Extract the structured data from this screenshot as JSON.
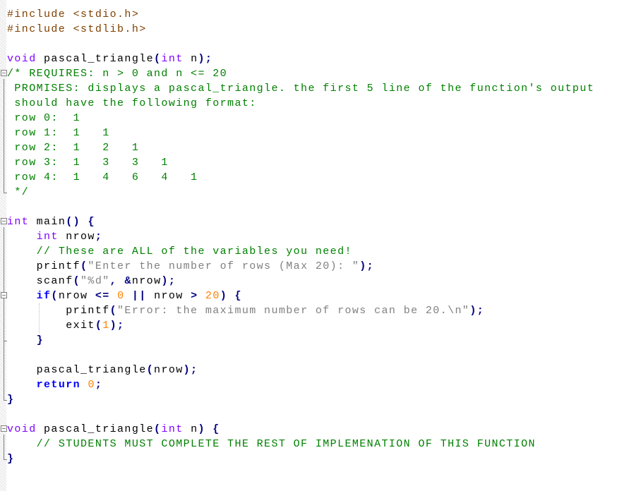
{
  "editor": {
    "lines": [
      [
        [
          "pp",
          "#include <stdio.h>"
        ]
      ],
      [
        [
          "pp",
          "#include <stdlib.h>"
        ]
      ],
      [],
      [
        [
          "type",
          "void"
        ],
        [
          "plain",
          " pascal_triangle"
        ],
        [
          "op",
          "("
        ],
        [
          "type",
          "int"
        ],
        [
          "plain",
          " n"
        ],
        [
          "op",
          ");"
        ]
      ],
      [
        [
          "cmt",
          "/* REQUIRES: n > 0 and n <= 20"
        ]
      ],
      [
        [
          "cmt",
          " PROMISES: displays a pascal_triangle. the first 5 line of the function's output"
        ]
      ],
      [
        [
          "cmt",
          " should have the following format:"
        ]
      ],
      [
        [
          "cmt",
          " row 0:  1"
        ]
      ],
      [
        [
          "cmt",
          " row 1:  1   1"
        ]
      ],
      [
        [
          "cmt",
          " row 2:  1   2   1"
        ]
      ],
      [
        [
          "cmt",
          " row 3:  1   3   3   1"
        ]
      ],
      [
        [
          "cmt",
          " row 4:  1   4   6   4   1"
        ]
      ],
      [
        [
          "cmt",
          " */"
        ]
      ],
      [],
      [
        [
          "type",
          "int"
        ],
        [
          "plain",
          " main"
        ],
        [
          "op",
          "()"
        ],
        [
          "plain",
          " "
        ],
        [
          "op",
          "{"
        ]
      ],
      [
        [
          "plain",
          "    "
        ],
        [
          "type",
          "int"
        ],
        [
          "plain",
          " nrow"
        ],
        [
          "op",
          ";"
        ]
      ],
      [
        [
          "plain",
          "    "
        ],
        [
          "cmt",
          "// These are ALL of the variables you need!"
        ]
      ],
      [
        [
          "plain",
          "    printf"
        ],
        [
          "op",
          "("
        ],
        [
          "str",
          "\"Enter the number of rows (Max 20): \""
        ],
        [
          "op",
          ");"
        ]
      ],
      [
        [
          "plain",
          "    scanf"
        ],
        [
          "op",
          "("
        ],
        [
          "str",
          "\"%d\""
        ],
        [
          "op",
          ","
        ],
        [
          "plain",
          " "
        ],
        [
          "op",
          "&"
        ],
        [
          "plain",
          "nrow"
        ],
        [
          "op",
          ");"
        ]
      ],
      [
        [
          "plain",
          "    "
        ],
        [
          "kw",
          "if"
        ],
        [
          "op",
          "("
        ],
        [
          "plain",
          "nrow "
        ],
        [
          "op",
          "<="
        ],
        [
          "plain",
          " "
        ],
        [
          "num",
          "0"
        ],
        [
          "plain",
          " "
        ],
        [
          "op",
          "||"
        ],
        [
          "plain",
          " nrow "
        ],
        [
          "op",
          ">"
        ],
        [
          "plain",
          " "
        ],
        [
          "num",
          "20"
        ],
        [
          "op",
          ")"
        ],
        [
          "plain",
          " "
        ],
        [
          "op",
          "{"
        ]
      ],
      [
        [
          "plain",
          "        printf"
        ],
        [
          "op",
          "("
        ],
        [
          "str",
          "\"Error: the maximum number of rows can be 20.\\n\""
        ],
        [
          "op",
          ");"
        ]
      ],
      [
        [
          "plain",
          "        exit"
        ],
        [
          "op",
          "("
        ],
        [
          "num",
          "1"
        ],
        [
          "op",
          ");"
        ]
      ],
      [
        [
          "plain",
          "    "
        ],
        [
          "op",
          "}"
        ]
      ],
      [],
      [
        [
          "plain",
          "    pascal_triangle"
        ],
        [
          "op",
          "("
        ],
        [
          "plain",
          "nrow"
        ],
        [
          "op",
          ");"
        ]
      ],
      [
        [
          "plain",
          "    "
        ],
        [
          "kw",
          "return"
        ],
        [
          "plain",
          " "
        ],
        [
          "num",
          "0"
        ],
        [
          "op",
          ";"
        ]
      ],
      [
        [
          "op",
          "}"
        ]
      ],
      [],
      [
        [
          "type",
          "void"
        ],
        [
          "plain",
          " pascal_triangle"
        ],
        [
          "op",
          "("
        ],
        [
          "type",
          "int"
        ],
        [
          "plain",
          " n"
        ],
        [
          "op",
          ")"
        ],
        [
          "plain",
          " "
        ],
        [
          "op",
          "{"
        ]
      ],
      [
        [
          "plain",
          "    "
        ],
        [
          "cmt",
          "// STUDENTS MUST COMPLETE THE REST OF IMPLEMENATION OF THIS FUNCTION"
        ]
      ],
      [
        [
          "op",
          "}"
        ]
      ]
    ]
  },
  "colors": {
    "preprocessor": "#804000",
    "type": "#8000ff",
    "keyword": "#0000ff",
    "operator": "#000080",
    "number": "#ff8000",
    "string": "#808080",
    "comment": "#008000"
  }
}
